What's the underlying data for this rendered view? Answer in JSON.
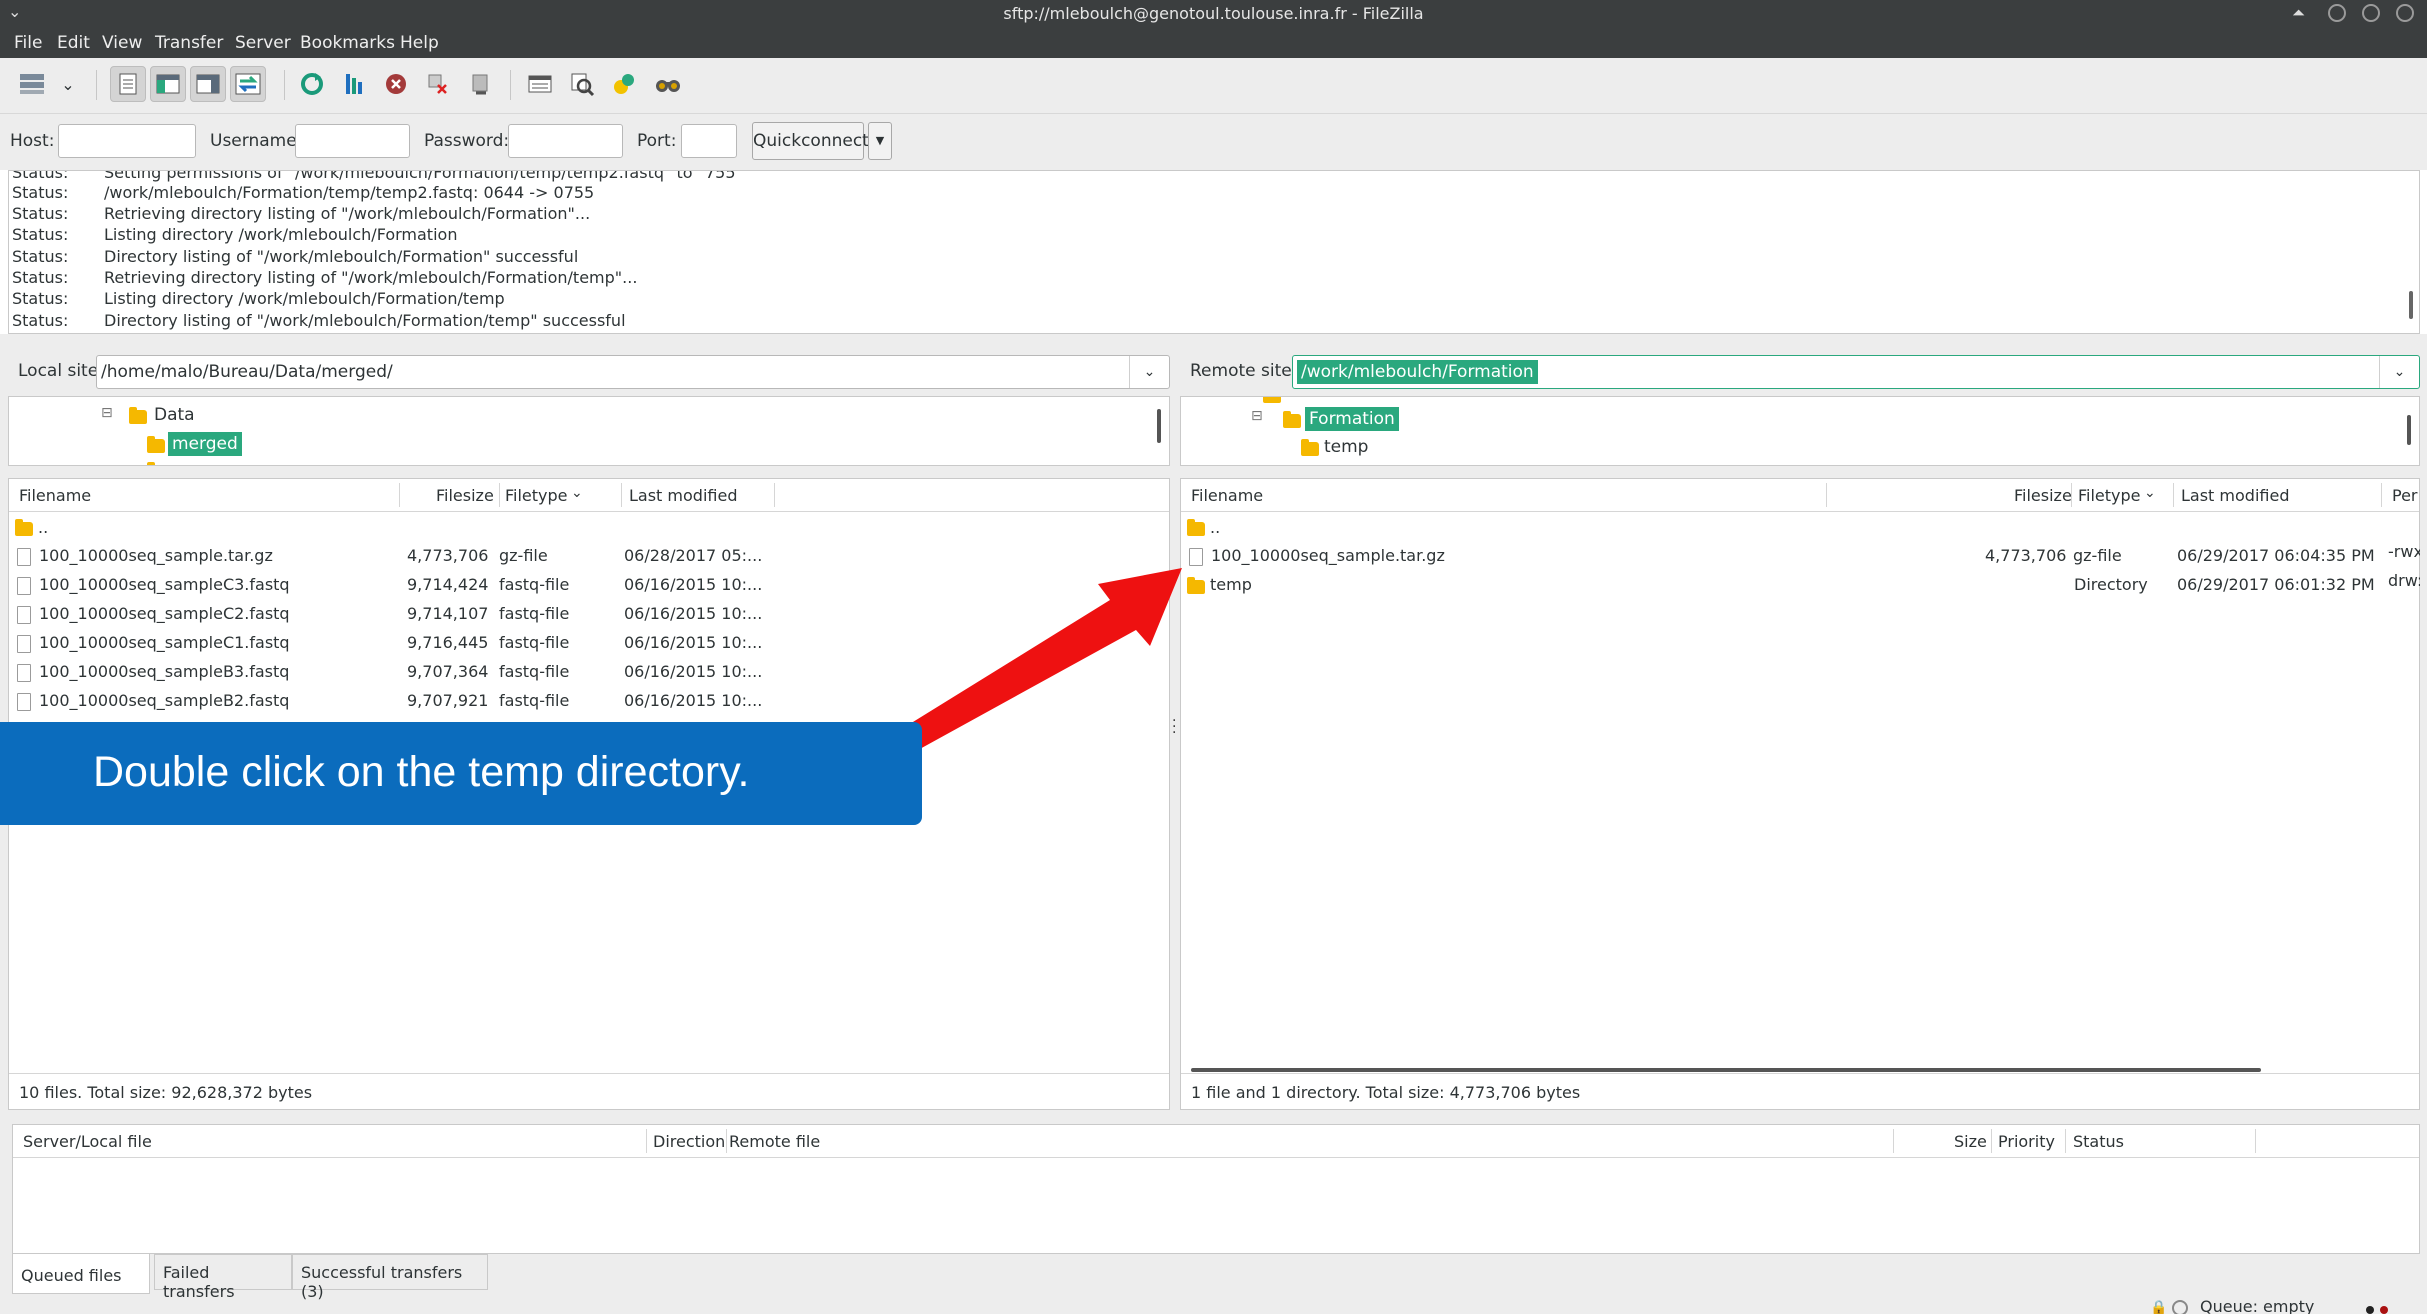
{
  "window": {
    "title": "sftp://mleboulch@genotoul.toulouse.inra.fr - FileZilla"
  },
  "menu": [
    "File",
    "Edit",
    "View",
    "Transfer",
    "Server",
    "Bookmarks",
    "Help"
  ],
  "toolbar": {
    "icons": [
      "site-manager-icon",
      "dropdown-arrow-icon",
      "message-log-toggle-icon",
      "local-tree-toggle-icon",
      "remote-tree-toggle-icon",
      "transfer-queue-toggle-icon",
      "refresh-icon",
      "process-queue-icon",
      "cancel-icon",
      "disconnect-icon",
      "reconnect-icon",
      "directory-filter-icon",
      "compare-icon",
      "sync-browsing-icon",
      "search-icon"
    ]
  },
  "quickconnect": {
    "host_label": "Host:",
    "username_label": "Username:",
    "password_label": "Password:",
    "port_label": "Port:",
    "button_label": "Quickconnect",
    "host_value": "",
    "username_value": "",
    "password_value": "",
    "port_value": ""
  },
  "log": {
    "partial_first": {
      "k": "Status:",
      "v": "Setting permissions of \"/work/mleboulch/Formation/temp/temp2.fastq\" to \"755\""
    },
    "rows": [
      {
        "k": "Status:",
        "v": "/work/mleboulch/Formation/temp/temp2.fastq: 0644 -> 0755"
      },
      {
        "k": "Status:",
        "v": "Retrieving directory listing of \"/work/mleboulch/Formation\"..."
      },
      {
        "k": "Status:",
        "v": "Listing directory /work/mleboulch/Formation"
      },
      {
        "k": "Status:",
        "v": "Directory listing of \"/work/mleboulch/Formation\" successful"
      },
      {
        "k": "Status:",
        "v": "Retrieving directory listing of \"/work/mleboulch/Formation/temp\"..."
      },
      {
        "k": "Status:",
        "v": "Listing directory /work/mleboulch/Formation/temp"
      },
      {
        "k": "Status:",
        "v": "Directory listing of \"/work/mleboulch/Formation/temp\" successful"
      }
    ]
  },
  "local": {
    "site_label": "Local site:",
    "path": "/home/malo/Bureau/Data/merged/",
    "tree": [
      {
        "name": "Data",
        "expanded": true
      },
      {
        "name": "merged",
        "selected": true
      }
    ],
    "columns": [
      "Filename",
      "Filesize",
      "Filetype",
      "Last modified"
    ],
    "files": [
      {
        "name": "..",
        "size": "",
        "type": "",
        "modified": "",
        "folder": true
      },
      {
        "name": "100_10000seq_sample.tar.gz",
        "size": "4,773,706",
        "type": "gz-file",
        "modified": "06/28/2017 05:..."
      },
      {
        "name": "100_10000seq_sampleC3.fastq",
        "size": "9,714,424",
        "type": "fastq-file",
        "modified": "06/16/2015 10:..."
      },
      {
        "name": "100_10000seq_sampleC2.fastq",
        "size": "9,714,107",
        "type": "fastq-file",
        "modified": "06/16/2015 10:..."
      },
      {
        "name": "100_10000seq_sampleC1.fastq",
        "size": "9,716,445",
        "type": "fastq-file",
        "modified": "06/16/2015 10:..."
      },
      {
        "name": "100_10000seq_sampleB3.fastq",
        "size": "9,707,364",
        "type": "fastq-file",
        "modified": "06/16/2015 10:..."
      },
      {
        "name": "100_10000seq_sampleB2.fastq",
        "size": "9,707,921",
        "type": "fastq-file",
        "modified": "06/16/2015 10:..."
      }
    ],
    "summary": "10 files. Total size: 92,628,372 bytes"
  },
  "remote": {
    "site_label": "Remote site:",
    "path": "/work/mleboulch/Formation",
    "tree": [
      {
        "name": "Formation",
        "expanded": true,
        "selected": true
      },
      {
        "name": "temp"
      }
    ],
    "columns": [
      "Filename",
      "Filesize",
      "Filetype",
      "Last modified",
      "Per"
    ],
    "files": [
      {
        "name": "..",
        "size": "",
        "type": "",
        "modified": "",
        "perm": "",
        "folder": true
      },
      {
        "name": "100_10000seq_sample.tar.gz",
        "size": "4,773,706",
        "type": "gz-file",
        "modified": "06/29/2017 06:04:35 PM",
        "perm": "-rwx"
      },
      {
        "name": "temp",
        "size": "",
        "type": "Directory",
        "modified": "06/29/2017 06:01:32 PM",
        "perm": "drw:",
        "folder": true
      }
    ],
    "summary": "1 file and 1 directory. Total size: 4,773,706 bytes"
  },
  "annotation": {
    "callout": "Double click on the temp directory.",
    "arrow_color": "#ee1111",
    "callout_color": "#0b6cbd"
  },
  "queue": {
    "columns": [
      "Server/Local file",
      "Direction",
      "Remote file",
      "Size",
      "Priority",
      "Status"
    ],
    "tabs": [
      "Queued files",
      "Failed transfers",
      "Successful transfers (3)"
    ],
    "status": "Queue: empty"
  },
  "colors": {
    "selection": "#2aa87e",
    "folder": "#f5b800",
    "titlebar": "#3b3e3f"
  }
}
